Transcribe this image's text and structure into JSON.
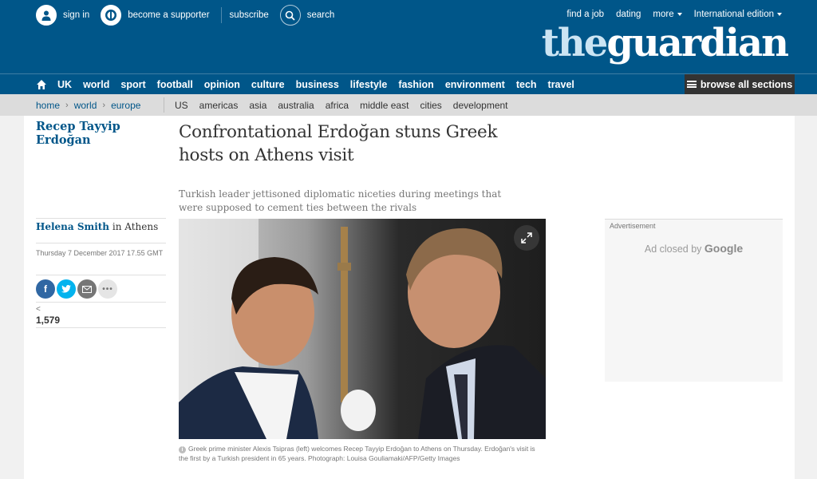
{
  "header": {
    "sign_in": "sign in",
    "become_supporter": "become a supporter",
    "subscribe": "subscribe",
    "search": "search",
    "find_job": "find a job",
    "dating": "dating",
    "more": "more",
    "edition": "International edition",
    "logo_the": "the",
    "logo_guardian": "guardian",
    "brand_color": "#005689"
  },
  "nav": {
    "items": [
      "UK",
      "world",
      "sport",
      "football",
      "opinion",
      "culture",
      "business",
      "lifestyle",
      "fashion",
      "environment",
      "tech",
      "travel"
    ],
    "browse": "browse all sections"
  },
  "subnav": {
    "breadcrumbs": [
      "home",
      "world",
      "europe"
    ],
    "links": [
      "US",
      "americas",
      "asia",
      "australia",
      "africa",
      "middle east",
      "cities",
      "development"
    ]
  },
  "article": {
    "tag": "Recep Tayyip Erdoğan",
    "headline": "Confrontational Erdoğan stuns Greek hosts on Athens visit",
    "standfirst": "Turkish leader jettisoned diplomatic niceties during meetings that were supposed to cement ties between the rivals",
    "author": "Helena Smith",
    "location": " in Athens",
    "date": "Thursday 7 December 2017 17.55 GMT",
    "share_count": "1,579",
    "caption": "Greek prime minister Alexis Tsipras (left) welcomes Recep Tayyip Erdoğan to Athens on Thursday. Erdoğan's visit is the first by a Turkish president in 65 years. Photograph: Louisa Gouliamaki/AFP/Getty Images"
  },
  "ad": {
    "label": "Advertisement",
    "closed_by": "Ad closed by ",
    "google": "Google"
  }
}
